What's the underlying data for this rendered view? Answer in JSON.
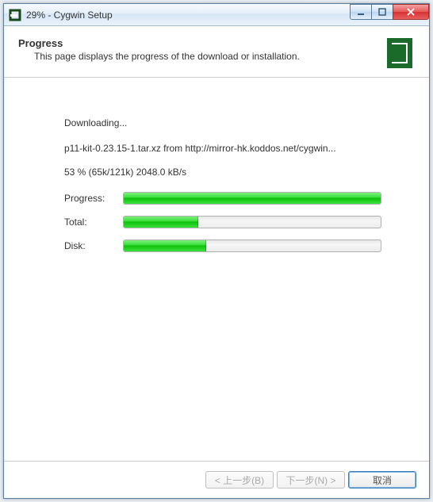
{
  "title": "29% - Cygwin Setup",
  "header": {
    "title": "Progress",
    "subtitle": "This page displays the progress of the download or installation."
  },
  "status": {
    "action": "Downloading...",
    "file": "p11-kit-0.23.15-1.tar.xz from http://mirror-hk.koddos.net/cygwin...",
    "percent_line": "53 %  (65k/121k)  2048.0 kB/s"
  },
  "bars": {
    "progress": {
      "label": "Progress:",
      "percent": 100
    },
    "total": {
      "label": "Total:",
      "percent": 29
    },
    "disk": {
      "label": "Disk:",
      "percent": 32
    }
  },
  "buttons": {
    "back": "< 上一步(B)",
    "next": "下一步(N) >",
    "cancel": "取消"
  }
}
